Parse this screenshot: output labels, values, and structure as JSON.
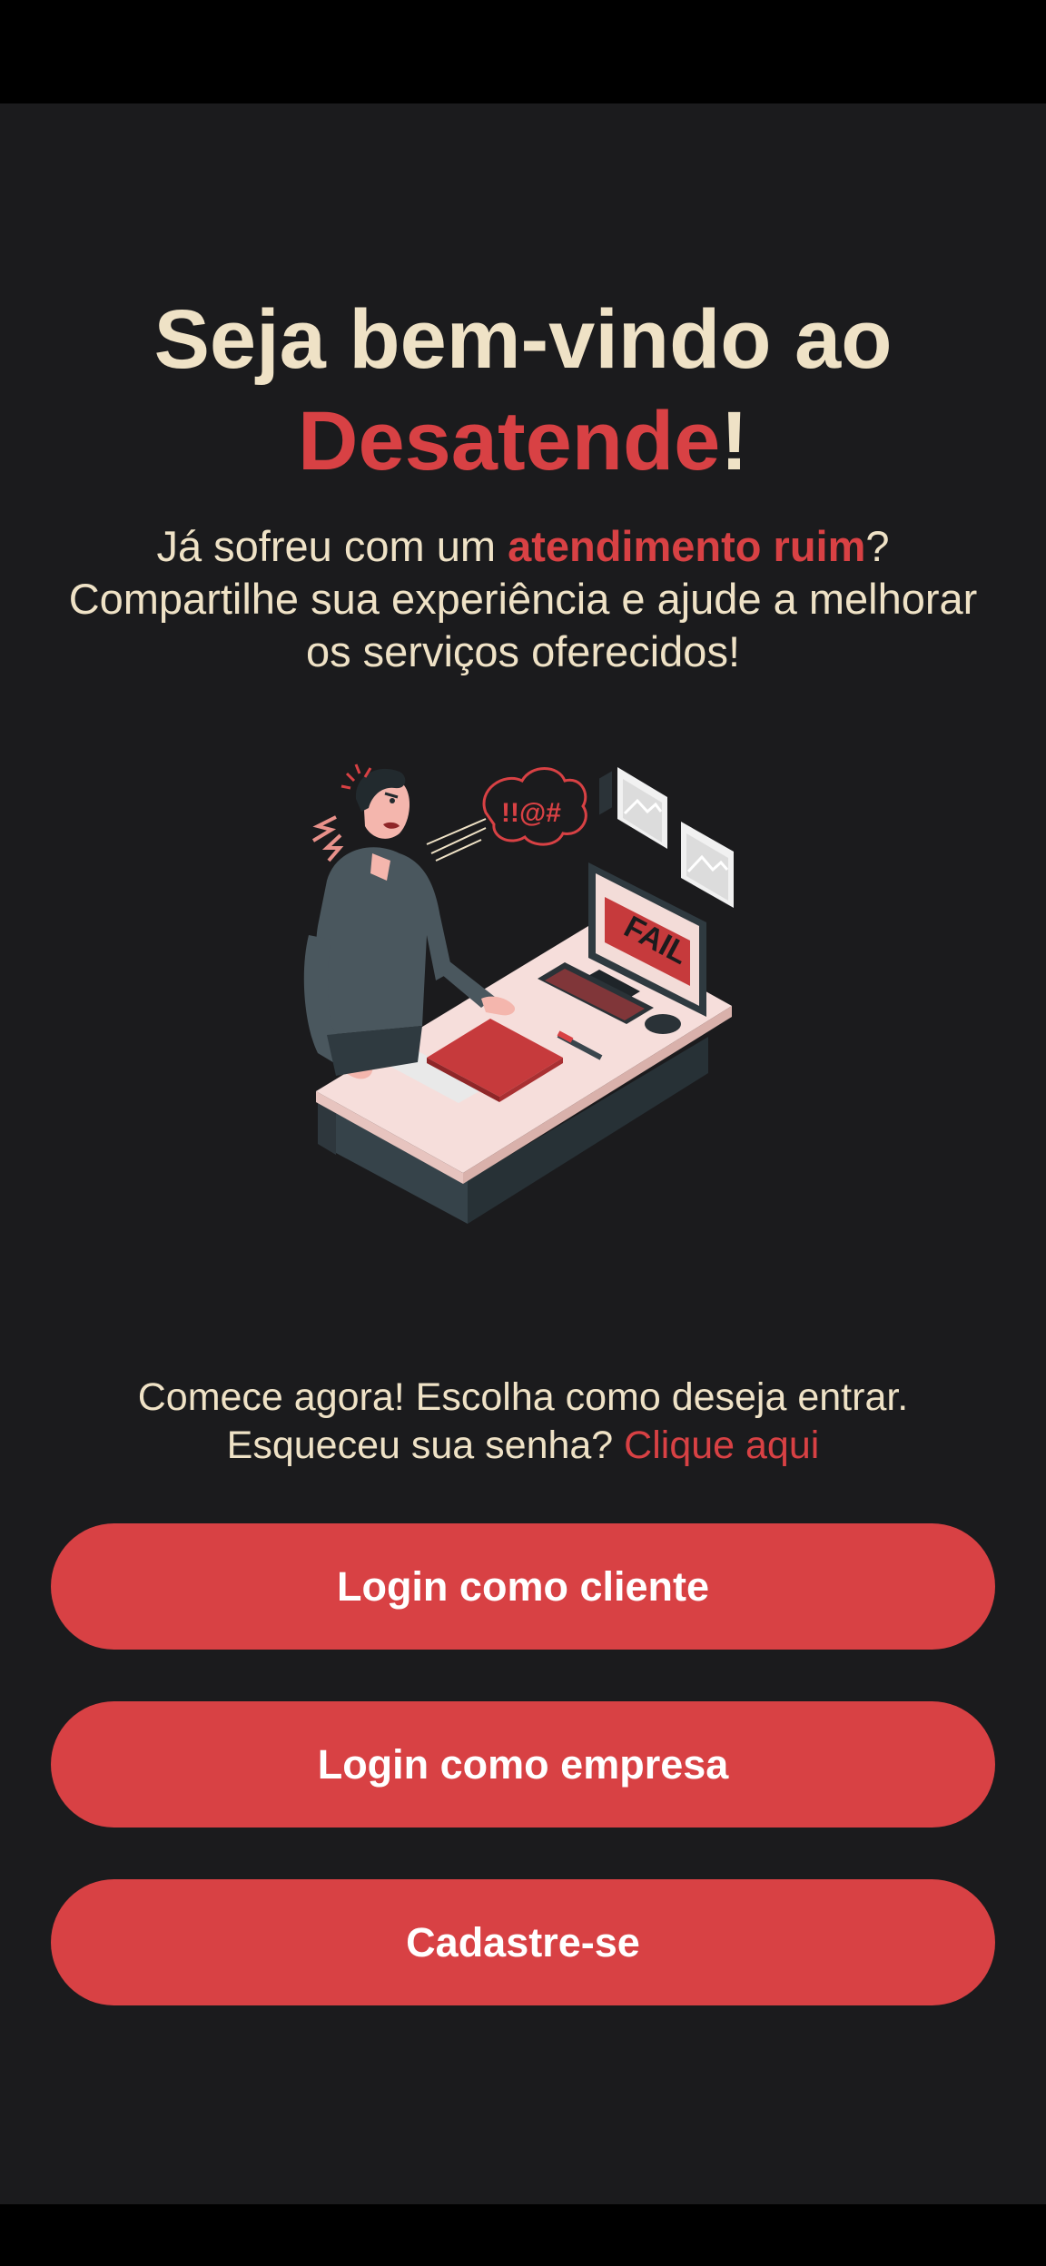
{
  "colors": {
    "background": "#1b1b1d",
    "text": "#efe2c6",
    "accent": "#d84144",
    "button_text": "#ffffff"
  },
  "welcome": {
    "title_line1": "Seja bem-vindo ao",
    "brand": "Desatende",
    "title_end": "!",
    "subtitle_pre": "Já sofreu com um ",
    "subtitle_accent": "atendimento ruim",
    "subtitle_post": "? Compartilhe sua experiência e ajude a melhorar os serviços oferecidos!"
  },
  "illustration": {
    "screen_text": "FAIL",
    "speech_text": "!!@#",
    "icon": "frustrated-user-illustration"
  },
  "prompt": {
    "line1": "Comece agora! Escolha como deseja entrar.",
    "line2_pre": "Esqueceu sua senha? ",
    "link": "Clique aqui"
  },
  "buttons": {
    "login_client": "Login como cliente",
    "login_company": "Login como empresa",
    "signup": "Cadastre-se"
  }
}
